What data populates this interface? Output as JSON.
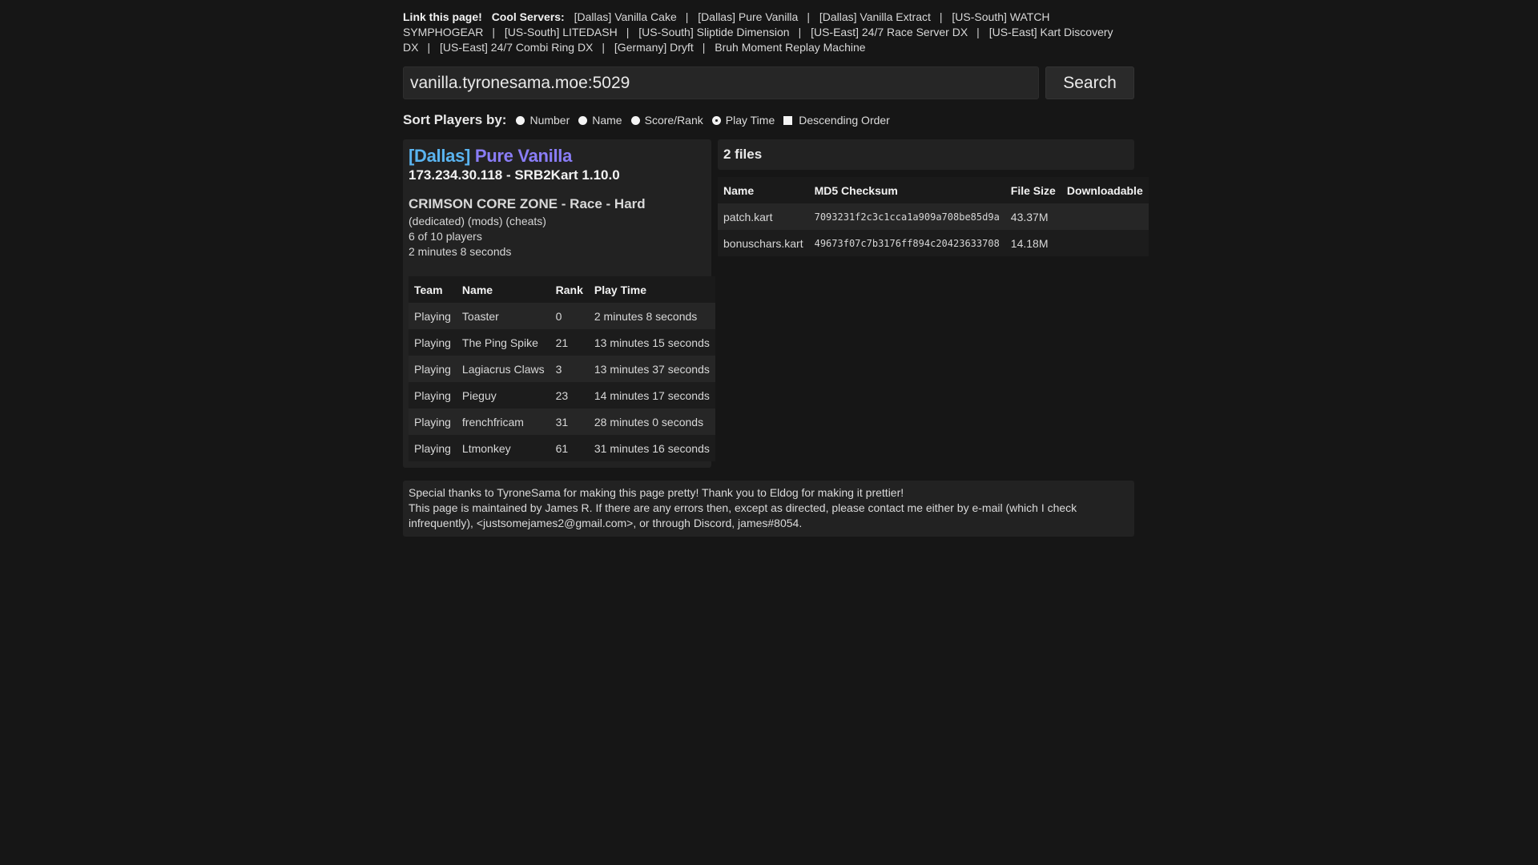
{
  "topnav": {
    "link_label": "Link this page!",
    "cool_label": "Cool Servers:",
    "servers": [
      "[Dallas] Vanilla Cake",
      "[Dallas] Pure Vanilla",
      "[Dallas] Vanilla Extract",
      "[US-South] WATCH SYMPHOGEAR",
      "[US-South] LITEDASH",
      "[US-South] Sliptide Dimension",
      "[US-East] 24/7 Race Server DX",
      "[US-East] Kart Discovery DX",
      "[US-East] 24/7 Combi Ring DX",
      "[Germany] Dryft",
      "Bruh Moment Replay Machine"
    ],
    "separator": "|"
  },
  "search": {
    "value": "vanilla.tyronesama.moe:5029",
    "button_label": "Search"
  },
  "sort": {
    "title": "Sort Players by:",
    "options": [
      "Number",
      "Name",
      "Score/Rank",
      "Play Time"
    ],
    "selected": "Play Time",
    "descending_label": "Descending Order"
  },
  "server": {
    "region": "[Dallas]",
    "name": "Pure Vanilla",
    "address": "173.234.30.118 - SRB2Kart 1.10.0",
    "map": "CRIMSON CORE ZONE - Race - Hard",
    "flags": "(dedicated) (mods) (cheats)",
    "players_count": "6 of 10 players",
    "uptime": "2 minutes 8 seconds"
  },
  "players": {
    "headers": [
      "Team",
      "Name",
      "Rank",
      "Play Time"
    ],
    "rows": [
      [
        "Playing",
        "Toaster",
        "0",
        "2 minutes 8 seconds"
      ],
      [
        "Playing",
        "The Ping Spike",
        "21",
        "13 minutes 15 seconds"
      ],
      [
        "Playing",
        "Lagiacrus Claws",
        "3",
        "13 minutes 37 seconds"
      ],
      [
        "Playing",
        "Pieguy",
        "23",
        "14 minutes 17 seconds"
      ],
      [
        "Playing",
        "frenchfricam",
        "31",
        "28 minutes 0 seconds"
      ],
      [
        "Playing",
        "Ltmonkey",
        "61",
        "31 minutes 16 seconds"
      ]
    ]
  },
  "files": {
    "title": "2 files",
    "headers": [
      "Name",
      "MD5 Checksum",
      "File Size",
      "Downloadable"
    ],
    "rows": [
      [
        "patch.kart",
        "7093231f2c3c1cca1a909a708be85d9a",
        "43.37M",
        ""
      ],
      [
        "bonuschars.kart",
        "49673f07c7b3176ff894c20423633708",
        "14.18M",
        ""
      ]
    ]
  },
  "footer": {
    "line1": "Special thanks to TyroneSama for making this page pretty! Thank you to Eldog for making it prettier!",
    "line2": "This page is maintained by James R. If there are any errors then, except as directed, please contact me either by e-mail (which I check infrequently), <justsomejames2@gmail.com>, or through Discord, james#8054."
  }
}
